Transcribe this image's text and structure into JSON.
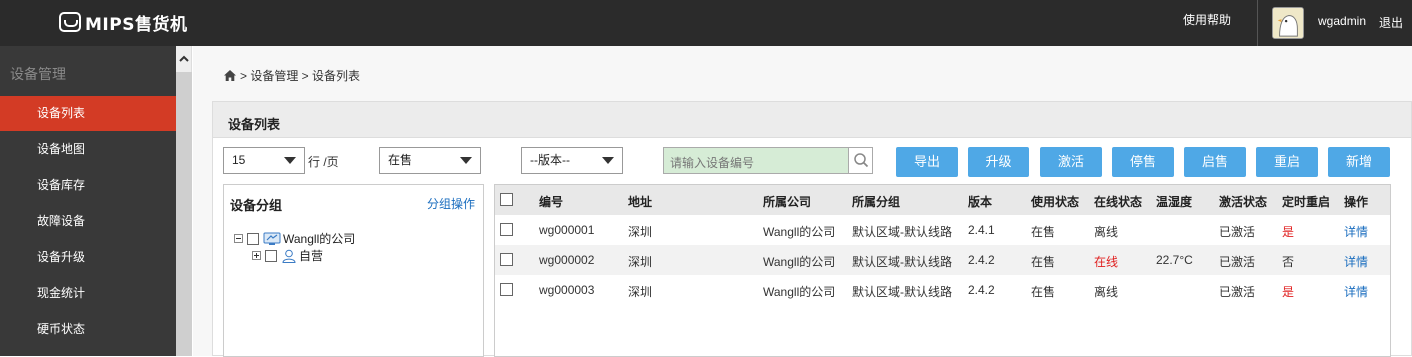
{
  "top": {
    "brand": "MIPS售货机",
    "help": "使用帮助",
    "user": "wgadmin",
    "logout": "退出"
  },
  "sidebar": {
    "title": "设备管理",
    "items": [
      {
        "label": "设备列表",
        "active": true
      },
      {
        "label": "设备地图"
      },
      {
        "label": "设备库存"
      },
      {
        "label": "故障设备"
      },
      {
        "label": "设备升级"
      },
      {
        "label": "现金统计"
      },
      {
        "label": "硬币状态"
      }
    ]
  },
  "breadcrumb": "> 设备管理 > 设备列表",
  "panel": {
    "title": "设备列表"
  },
  "toolbar": {
    "pagesize": "15",
    "perpage": "行 /页",
    "status_select": "在售",
    "version_select": "--版本--",
    "search_placeholder": "请输入设备编号",
    "buttons": [
      "导出",
      "升级",
      "激活",
      "停售",
      "启售",
      "重启",
      "新增"
    ]
  },
  "tree": {
    "title": "设备分组",
    "op": "分组操作",
    "root": "Wangll的公司",
    "child": "自营"
  },
  "table": {
    "headers": [
      "编号",
      "地址",
      "所属公司",
      "所属分组",
      "版本",
      "使用状态",
      "在线状态",
      "温湿度",
      "激活状态",
      "定时重启",
      "操作"
    ],
    "rows": [
      {
        "id": "wg000001",
        "addr": "深圳",
        "company": "Wangll的公司",
        "group": "默认区域-默认线路",
        "ver": "2.4.1",
        "use": "在售",
        "online": "离线",
        "temp": "",
        "active": "已激活",
        "reboot": "是",
        "op": "详情"
      },
      {
        "id": "wg000002",
        "addr": "深圳",
        "company": "Wangll的公司",
        "group": "默认区域-默认线路",
        "ver": "2.4.2",
        "use": "在售",
        "online": "在线",
        "temp": "22.7°C",
        "active": "已激活",
        "reboot": "否",
        "op": "详情"
      },
      {
        "id": "wg000003",
        "addr": "深圳",
        "company": "Wangll的公司",
        "group": "默认区域-默认线路",
        "ver": "2.4.2",
        "use": "在售",
        "online": "离线",
        "temp": "",
        "active": "已激活",
        "reboot": "是",
        "op": "详情"
      }
    ]
  },
  "colors": {
    "accent_red": "#d33b25",
    "button_blue": "#4fa8e6",
    "topbar": "#2b2b2b",
    "sidebar": "#393939"
  }
}
